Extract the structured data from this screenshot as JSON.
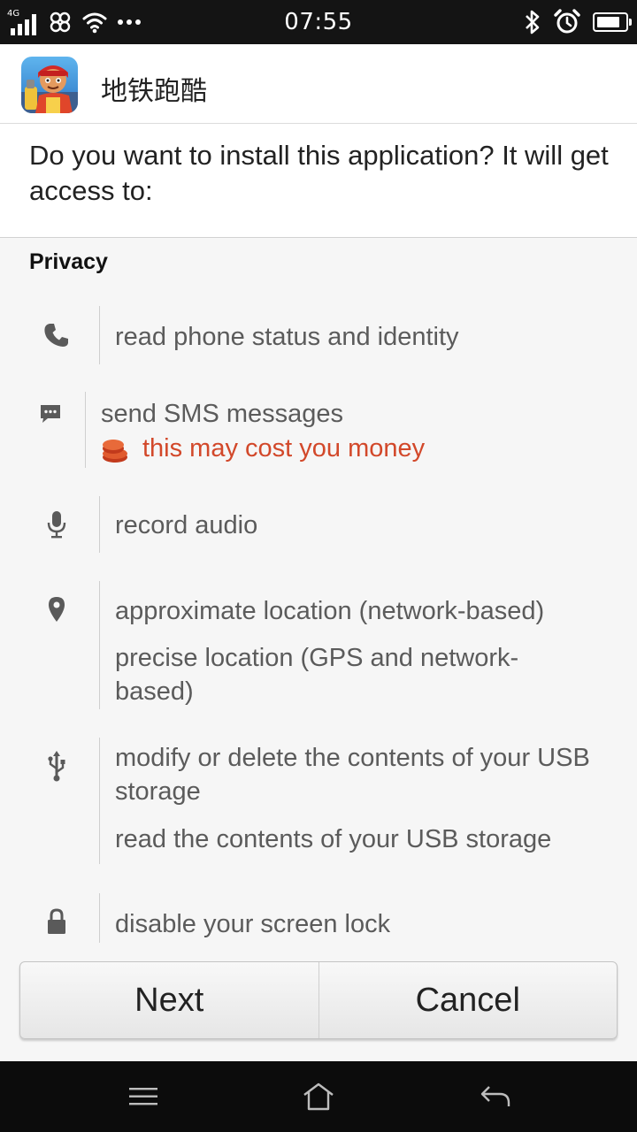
{
  "status_bar": {
    "network_type": "4G",
    "time": "07:55",
    "battery_level": 0.85
  },
  "header": {
    "app_name": "地铁跑酷",
    "app_icon": "subway-surfers-app-icon"
  },
  "prompt": "Do you want to install this application? It will get access to:",
  "section_title": "Privacy",
  "permissions": {
    "phone": {
      "icon": "phone-icon",
      "items": [
        "read phone status and identity"
      ]
    },
    "sms": {
      "icon": "sms-icon",
      "items": [
        "send SMS messages"
      ],
      "warning": "this may cost you money",
      "warning_icon": "coins-icon"
    },
    "audio": {
      "icon": "microphone-icon",
      "items": [
        "record audio"
      ]
    },
    "location": {
      "icon": "location-pin-icon",
      "items": [
        "approximate location (network-based)",
        "precise location (GPS and network-based)"
      ]
    },
    "storage": {
      "icon": "usb-icon",
      "items": [
        "modify or delete the contents of your USB storage",
        "read the contents of your USB storage"
      ]
    },
    "lock": {
      "icon": "lock-icon",
      "items": [
        "disable your screen lock"
      ]
    }
  },
  "buttons": {
    "next": "Next",
    "cancel": "Cancel"
  },
  "nav": {
    "menu": "menu-icon",
    "home": "home-icon",
    "back": "back-icon"
  },
  "colors": {
    "warning": "#d2482a",
    "status_bar": "#141414",
    "background": "#f6f6f6"
  }
}
